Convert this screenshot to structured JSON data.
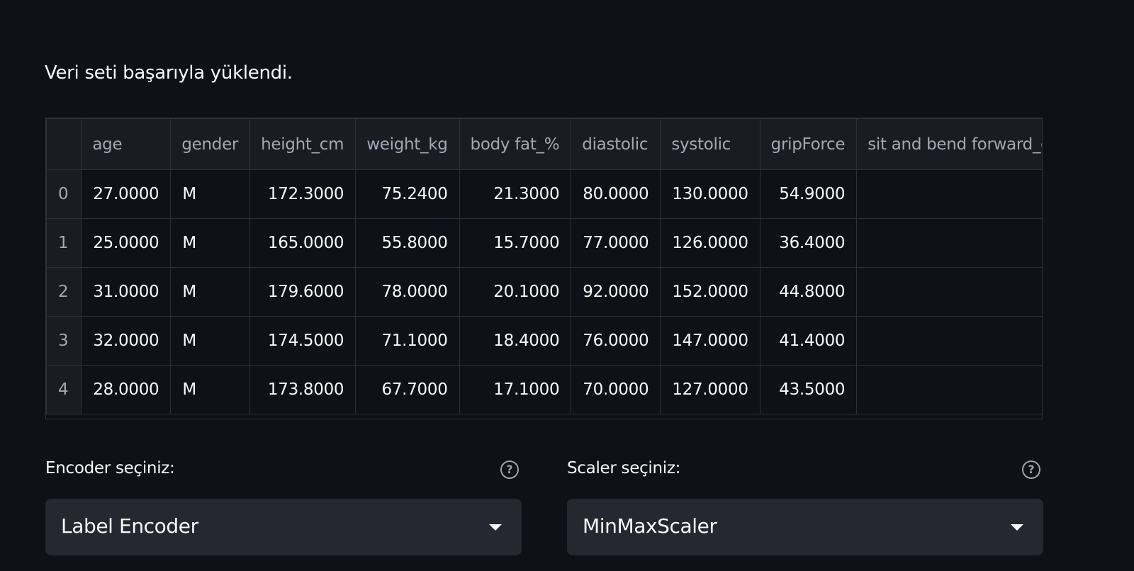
{
  "status": {
    "message": "Veri seti başarıyla yüklendi."
  },
  "table": {
    "columns": [
      "",
      "age",
      "gender",
      "height_cm",
      "weight_kg",
      "body fat_%",
      "diastolic",
      "systolic",
      "gripForce",
      "sit and bend forward_cm"
    ],
    "rows": [
      {
        "index": "0",
        "age": "27.0000",
        "gender": "M",
        "height_cm": "172.3000",
        "weight_kg": "75.2400",
        "body_fat": "21.3000",
        "diastolic": "80.0000",
        "systolic": "130.0000",
        "gripForce": "54.9000"
      },
      {
        "index": "1",
        "age": "25.0000",
        "gender": "M",
        "height_cm": "165.0000",
        "weight_kg": "55.8000",
        "body_fat": "15.7000",
        "diastolic": "77.0000",
        "systolic": "126.0000",
        "gripForce": "36.4000"
      },
      {
        "index": "2",
        "age": "31.0000",
        "gender": "M",
        "height_cm": "179.6000",
        "weight_kg": "78.0000",
        "body_fat": "20.1000",
        "diastolic": "92.0000",
        "systolic": "152.0000",
        "gripForce": "44.8000"
      },
      {
        "index": "3",
        "age": "32.0000",
        "gender": "M",
        "height_cm": "174.5000",
        "weight_kg": "71.1000",
        "body_fat": "18.4000",
        "diastolic": "76.0000",
        "systolic": "147.0000",
        "gripForce": "41.4000"
      },
      {
        "index": "4",
        "age": "28.0000",
        "gender": "M",
        "height_cm": "173.8000",
        "weight_kg": "67.7000",
        "body_fat": "17.1000",
        "diastolic": "70.0000",
        "systolic": "127.0000",
        "gripForce": "43.5000"
      }
    ]
  },
  "encoder": {
    "label": "Encoder seçiniz:",
    "help_icon": "question-circle-icon",
    "selected": "Label Encoder"
  },
  "scaler": {
    "label": "Scaler seçiniz:",
    "help_icon": "question-circle-icon",
    "selected": "MinMaxScaler"
  },
  "colors": {
    "background": "#0e1117",
    "header_background": "#1a1c24",
    "select_background": "#262730",
    "text": "#fafafa",
    "muted_text": "#a3a8b4"
  }
}
